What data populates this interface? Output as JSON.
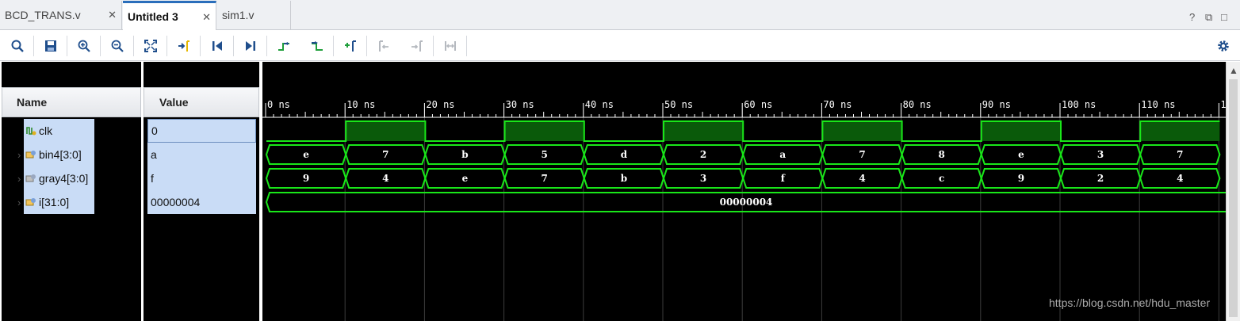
{
  "tabs": [
    {
      "label": "BCD_TRANS.v",
      "active": false
    },
    {
      "label": "Untitled 3",
      "active": true
    },
    {
      "label": "sim1.v",
      "active": false
    }
  ],
  "window_controls": {
    "help": "?",
    "restore": "⧉",
    "maximize": "□"
  },
  "toolbar": {
    "icons": [
      "search-icon",
      "save-icon",
      "zoom-in-icon",
      "zoom-out-icon",
      "zoom-fit-icon",
      "go-to-cursor-icon",
      "go-to-time-zero-icon",
      "go-to-last-time-icon",
      "previous-transition-icon",
      "next-transition-icon",
      "add-marker-icon",
      "previous-marker-icon",
      "next-marker-icon",
      "swap-cursors-icon",
      "settings-icon"
    ]
  },
  "headers": {
    "name": "Name",
    "value": "Value"
  },
  "signals": [
    {
      "name": "clk",
      "value": "0",
      "kind": "bit",
      "expandable": false
    },
    {
      "name": "bin4[3:0]",
      "value": "a",
      "kind": "bus",
      "expandable": true
    },
    {
      "name": "gray4[3:0]",
      "value": "f",
      "kind": "bus",
      "expandable": true
    },
    {
      "name": "i[31:0]",
      "value": "00000004",
      "kind": "bus",
      "expandable": true
    }
  ],
  "timeline": {
    "tick_labels": [
      "0 ns",
      "10 ns",
      "20 ns",
      "30 ns",
      "40 ns",
      "50 ns",
      "60 ns",
      "70 ns",
      "80 ns",
      "90 ns",
      "100 ns",
      "110 ns",
      "1"
    ],
    "ns_per_major": 10
  },
  "waveforms": {
    "clk": [
      0,
      1,
      0,
      1,
      0,
      1,
      0,
      1,
      0,
      1,
      0,
      1
    ],
    "bin4": [
      "e",
      "7",
      "b",
      "5",
      "d",
      "2",
      "a",
      "7",
      "8",
      "e",
      "3",
      "7"
    ],
    "gray4": [
      "9",
      "4",
      "e",
      "7",
      "b",
      "3",
      "f",
      "4",
      "c",
      "9",
      "2",
      "4"
    ],
    "i": "00000004"
  },
  "colors": {
    "wave": "#19e619",
    "wave_fill": "#0a5a0a",
    "grid": "#3c3c3c",
    "selection": "#c9dcf6",
    "accent": "#2a6ebb"
  },
  "watermark": "https://blog.csdn.net/hdu_master"
}
